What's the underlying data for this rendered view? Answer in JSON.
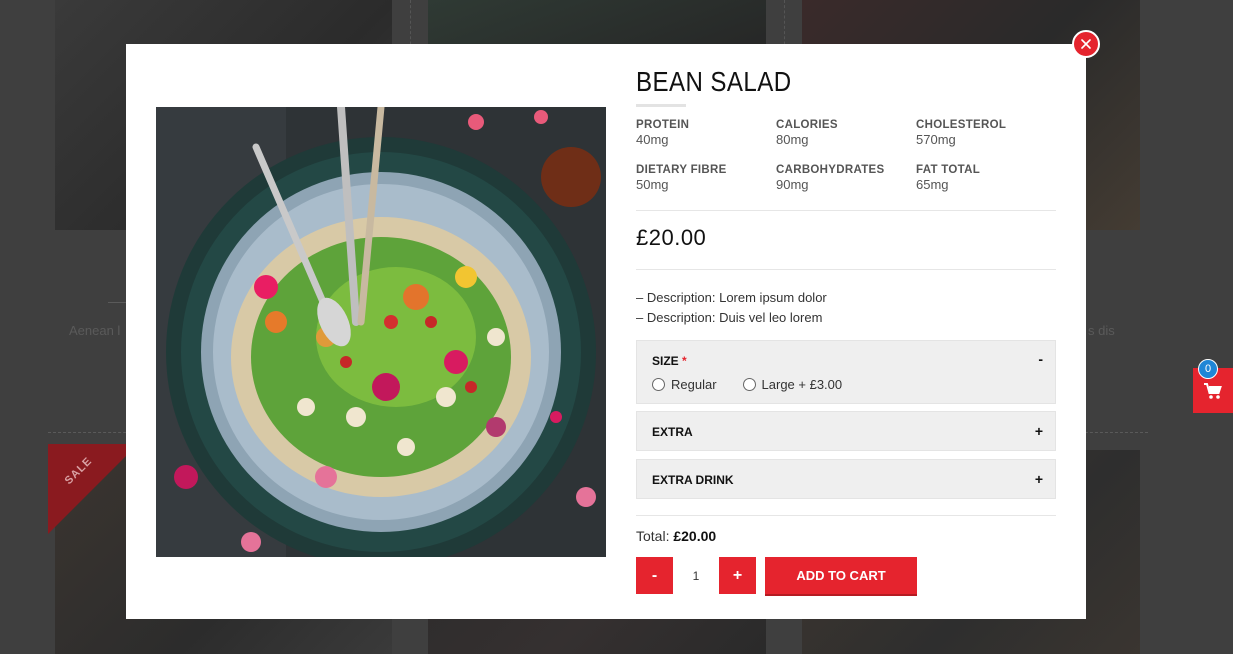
{
  "background": {
    "text_left": "Aenean l",
    "text_right": "s dis",
    "sale_badge": "SALE",
    "cart_count": "0"
  },
  "modal": {
    "close_icon": "close-icon",
    "title": "BEAN SALAD",
    "nutrition": [
      {
        "label": "PROTEIN",
        "value": "40mg"
      },
      {
        "label": "CALORIES",
        "value": "80mg"
      },
      {
        "label": "CHOLESTEROL",
        "value": "570mg"
      },
      {
        "label": "DIETARY FIBRE",
        "value": "50mg"
      },
      {
        "label": "CARBOHYDRATES",
        "value": "90mg"
      },
      {
        "label": "FAT TOTAL",
        "value": "65mg"
      }
    ],
    "price": "£20.00",
    "descriptions": [
      "– Description: Lorem ipsum dolor",
      "– Description: Duis vel leo lorem"
    ],
    "options": {
      "size": {
        "label": "SIZE",
        "required_mark": "*",
        "toggle": "-",
        "choices": [
          "Regular",
          "Large + £3.00"
        ]
      },
      "extra": {
        "label": "EXTRA",
        "toggle": "+"
      },
      "extra_drink": {
        "label": "EXTRA DRINK",
        "toggle": "+"
      }
    },
    "total_label": "Total:",
    "total_value": "£20.00",
    "quantity": "1",
    "minus_label": "-",
    "plus_label": "+",
    "add_to_cart": "ADD TO CART"
  },
  "colors": {
    "accent": "#e5242e",
    "badge": "#1f86d6"
  }
}
